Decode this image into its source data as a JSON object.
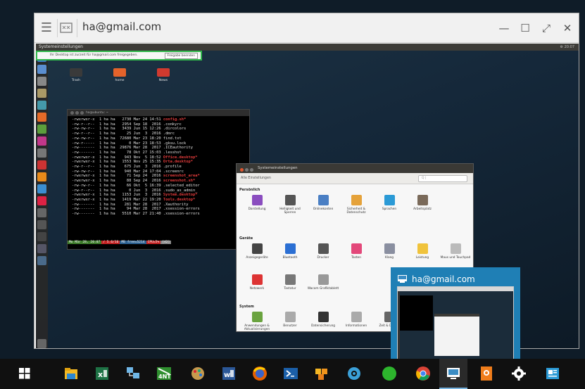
{
  "window": {
    "title": "ha@gmail.com",
    "controls": {
      "minimize": "—",
      "maximize": "☐",
      "fullscreen": "⤢",
      "close": "✕"
    }
  },
  "remote": {
    "topbar_title": "Systemeinstellungen",
    "topbar_right": "⚙ 20:07",
    "share_banner": {
      "text": "Ihr Desktop ist zurzeit für ha@gmail.com freigegeben.",
      "stop_label": "Freigabe beenden"
    },
    "desktop_icons": [
      {
        "label": "Trash"
      },
      {
        "label": "home"
      },
      {
        "label": "News"
      }
    ],
    "terminal": {
      "title": "ha@ubuntu: ~",
      "lines": [
        {
          "perm": "-rwxrwxr-x",
          "n": "1",
          "u": "ha",
          "g": "ha",
          "size": "2730",
          "date": "Mar 24 14:51",
          "name": "config.sh*",
          "style": "hl"
        },
        {
          "perm": "-rw-r--r--",
          "n": "1",
          "u": "ha",
          "g": "ha",
          "size": "2954",
          "date": "Sep 18  2016",
          "name": ".conkyrc",
          "style": ""
        },
        {
          "perm": "-rw-rw-r--",
          "n": "1",
          "u": "ha",
          "g": "ha",
          "size": "3439",
          "date": "Jun 15 12:26",
          "name": ".dircolors",
          "style": ""
        },
        {
          "perm": "-rw-r--r--",
          "n": "1",
          "u": "ha",
          "g": "ha",
          "size": "25",
          "date": "Jun  3  2016",
          "name": ".dmrc",
          "style": ""
        },
        {
          "perm": "-rw-rw-r--",
          "n": "1",
          "u": "ha",
          "g": "ha",
          "size": "72680",
          "date": "Mar 23 18:20",
          "name": "find.txt",
          "style": ""
        },
        {
          "perm": "-rw-r-----",
          "n": "1",
          "u": "ha",
          "g": "ha",
          "size": "0",
          "date": "Mar 23 18:53",
          "name": ".gksu.lock",
          "style": ""
        },
        {
          "perm": "-rw-------",
          "n": "1",
          "u": "ha",
          "g": "ha",
          "size": "29876",
          "date": "Mar 28  2017",
          "name": ".ICEauthority",
          "style": ""
        },
        {
          "perm": "-rw-------",
          "n": "1",
          "u": "ha",
          "g": "ha",
          "size": "78",
          "date": "Okt 27 15:03",
          "name": ".lesshst",
          "style": ""
        },
        {
          "perm": "-rwxrwxr-x",
          "n": "1",
          "u": "ha",
          "g": "ha",
          "size": "943",
          "date": "Nov  5 18:52",
          "name": "Office.desktop*",
          "style": "hl"
        },
        {
          "perm": "-rwxrwxr-x",
          "n": "1",
          "u": "ha",
          "g": "ha",
          "size": "1553",
          "date": "Nov 25 15:35",
          "name": "Orta.desktop*",
          "style": "hl"
        },
        {
          "perm": "-rw-r--r--",
          "n": "1",
          "u": "ha",
          "g": "ha",
          "size": "675",
          "date": "Jun  3  2016",
          "name": ".profile",
          "style": ""
        },
        {
          "perm": "-rw-rw-r--",
          "n": "1",
          "u": "ha",
          "g": "ha",
          "size": "940",
          "date": "Mar 24 17:04",
          "name": ".screenrc",
          "style": ""
        },
        {
          "perm": "-rwxrwxr-x",
          "n": "1",
          "u": "ha",
          "g": "ha",
          "size": "71",
          "date": "Sep 24  2016",
          "name": "screenshot_area*",
          "style": "hl"
        },
        {
          "perm": "-rwxrwxr-x",
          "n": "1",
          "u": "ha",
          "g": "ha",
          "size": "88",
          "date": "Sep 24  2016",
          "name": "screenshot.sh*",
          "style": "hl"
        },
        {
          "perm": "-rw-rw-r--",
          "n": "1",
          "u": "ha",
          "g": "ha",
          "size": "66",
          "date": "Okt  5 16:39",
          "name": ".selected_editor",
          "style": ""
        },
        {
          "perm": "-rw-r--r--",
          "n": "1",
          "u": "ha",
          "g": "ha",
          "size": "0",
          "date": "Jun  3  2016",
          "name": ".sudo_as_admin_",
          "style": ""
        },
        {
          "perm": "-rwxrwxr-x",
          "n": "1",
          "u": "ha",
          "g": "ha",
          "size": "1153",
          "date": "Jun  3  2016",
          "name": "System.desktop*",
          "style": "hl"
        },
        {
          "perm": "-rwxrwxr-x",
          "n": "1",
          "u": "ha",
          "g": "ha",
          "size": "1419",
          "date": "Mar 22 19:20",
          "name": "Tools.desktop*",
          "style": "hl"
        },
        {
          "perm": "-rw-------",
          "n": "1",
          "u": "ha",
          "g": "ha",
          "size": "281",
          "date": "Mar 28  2017",
          "name": ".Xauthority",
          "style": ""
        },
        {
          "perm": "-rw-------",
          "n": "1",
          "u": "ha",
          "g": "ha",
          "size": "94",
          "date": "Mar 28  2017",
          "name": ".xsession-errors",
          "style": ""
        },
        {
          "perm": "-rw-------",
          "n": "1",
          "u": "ha",
          "g": "ha",
          "size": "5510",
          "date": "Mar 27 21:40",
          "name": ".xsession-errors",
          "style": ""
        }
      ],
      "status": {
        "date": "Mo Mär 28, 20:07",
        "disk": "/ 5.6/16",
        "mem": "MB free=5214",
        "cpu": "CPU=5%",
        "num": "[42]"
      }
    },
    "settings": {
      "title": "Systemeinstellungen",
      "toolbar_left": "Alle Einstellungen",
      "search_placeholder": "Q |",
      "sections": {
        "personal": "Persönlich",
        "hardware": "Geräte",
        "system": "System"
      },
      "personal_items": [
        {
          "label": "Darstellung"
        },
        {
          "label": "Helligkeit und Sperren"
        },
        {
          "label": "Onlinekonten"
        },
        {
          "label": "Sicherheit & Datenschutz"
        },
        {
          "label": "Sprachen"
        },
        {
          "label": "Arbeitsplatz"
        }
      ],
      "hardware_items": [
        {
          "label": "Anzeigegeräte"
        },
        {
          "label": "Bluetooth"
        },
        {
          "label": "Drucker"
        },
        {
          "label": "Tasten"
        },
        {
          "label": "Klang"
        },
        {
          "label": "Leistung"
        },
        {
          "label": "Maus und Touchpad"
        },
        {
          "label": "Netzwerk"
        },
        {
          "label": "Tastatur"
        },
        {
          "label": "Wacom Grafiktablett"
        }
      ],
      "system_items": [
        {
          "label": "Anwendungen & Aktualisierungen"
        },
        {
          "label": "Benutzer"
        },
        {
          "label": "Datensicherung"
        },
        {
          "label": "Informationen"
        },
        {
          "label": "Zeit & Datum"
        }
      ]
    }
  },
  "preview": {
    "title": "ha@gmail.com"
  },
  "taskbar": {
    "items": [
      {
        "name": "start-icon"
      },
      {
        "name": "file-explorer-icon"
      },
      {
        "name": "excel-icon"
      },
      {
        "name": "network-icon"
      },
      {
        "name": "total-commander-icon"
      },
      {
        "name": "paint-icon"
      },
      {
        "name": "word-icon"
      },
      {
        "name": "firefox-icon"
      },
      {
        "name": "powershell-icon"
      },
      {
        "name": "puzzle-icon"
      },
      {
        "name": "settings-gear-icon"
      },
      {
        "name": "green-circle-icon"
      },
      {
        "name": "chrome-icon"
      },
      {
        "name": "remote-desktop-icon"
      },
      {
        "name": "photo-viewer-icon"
      },
      {
        "name": "gear-icon"
      },
      {
        "name": "news-icon"
      }
    ]
  },
  "colors": {
    "accent_blue": "#1f7fb5",
    "share_border": "#31b84b",
    "terminal_red": "#e23b3b"
  }
}
